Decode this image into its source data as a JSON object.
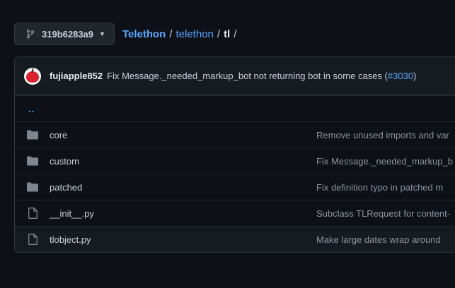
{
  "branch": {
    "label": "319b6283a9",
    "icon": "git-branch-icon"
  },
  "breadcrumb": {
    "root": "Telethon",
    "sep1": "/",
    "dir": "telethon",
    "sep2": "/",
    "current": "tl",
    "sep3": "/"
  },
  "commit": {
    "author": "fujiapple852",
    "message": "Fix Message._needed_markup_bot not returning bot in some cases (",
    "link": "#3030",
    "close": ")"
  },
  "parent_dir": "..",
  "files": [
    {
      "type": "dir",
      "icon": "folder-icon",
      "name": "core",
      "message": "Remove unused imports and var"
    },
    {
      "type": "dir",
      "icon": "folder-icon",
      "name": "custom",
      "message": "Fix Message._needed_markup_b"
    },
    {
      "type": "dir",
      "icon": "folder-icon",
      "name": "patched",
      "message": "Fix definition typo in patched m"
    },
    {
      "type": "file",
      "icon": "file-icon",
      "name": "__init__.py",
      "message": "Subclass TLRequest for content-"
    },
    {
      "type": "file",
      "icon": "file-icon",
      "name": "tlobject.py",
      "message": "Make large dates wrap around"
    }
  ],
  "colors": {
    "background": "#0d1117",
    "accent": "#58a6ff",
    "border": "#30363d",
    "muted": "#8b949e"
  }
}
